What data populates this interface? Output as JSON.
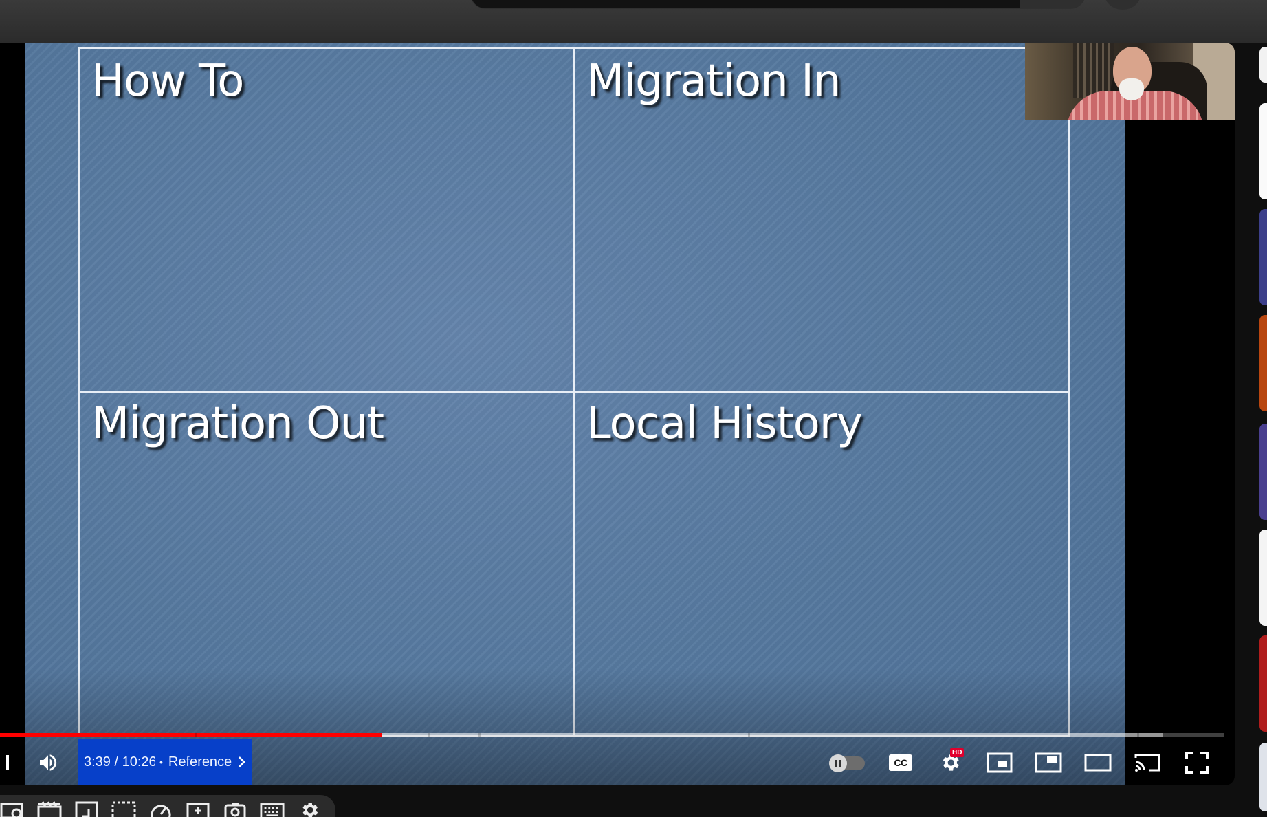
{
  "slide": {
    "cells": [
      "How To",
      "Migration In",
      "Migration Out",
      "Local History"
    ]
  },
  "player": {
    "time_display": "3:39 / 10:26",
    "chapter_separator": "•",
    "chapter_title": "Reference",
    "progress": {
      "played_fraction": 0.312,
      "buffered_fraction": 0.95
    },
    "cc_label": "CC",
    "hd_badge": "HD",
    "autoplay_on": false
  },
  "colors": {
    "slide_blue": "#56799f",
    "played_red": "#ff0000",
    "time_highlight": "#0740c9"
  },
  "icons": {
    "controls": [
      "next-icon",
      "volume-icon",
      "autoplay-toggle",
      "cc-icon",
      "settings-icon",
      "miniplayer-icon",
      "theater-icon",
      "fullscreen-window-icon",
      "cast-icon",
      "fullscreen-icon"
    ],
    "extensions": [
      "screenshot-icon",
      "clapper-icon",
      "crop-icon",
      "selection-icon",
      "speed-icon",
      "effects-icon",
      "camera-icon",
      "keyboard-icon",
      "gear-icon"
    ]
  }
}
